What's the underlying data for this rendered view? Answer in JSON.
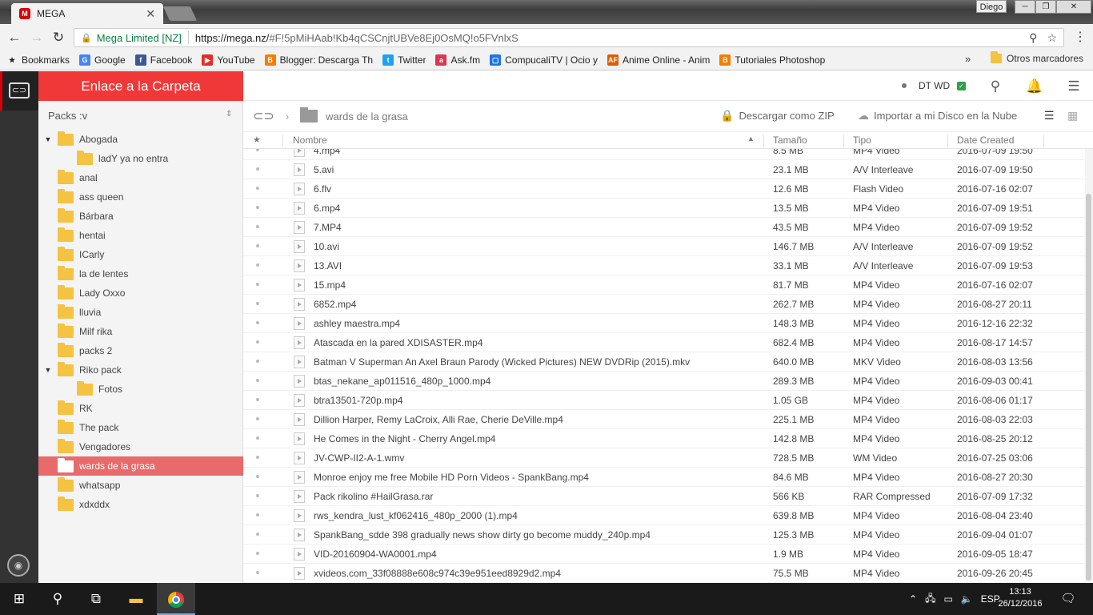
{
  "browser": {
    "tab_title": "MEGA",
    "tab_favicon": "M",
    "user_name": "Diego",
    "url_secure_label": "Mega Limited [NZ]",
    "url_host": "https://mega.nz/",
    "url_rest": "#F!5pMiHAab!Kb4qCSCnjtUBVe8Ej0OsMQ!o5FVnlxS",
    "bookmarks": [
      {
        "label": "Bookmarks",
        "icon": "star-icon",
        "color": "#222222"
      },
      {
        "label": "Google",
        "icon": "google-icon",
        "color": "#4285f4"
      },
      {
        "label": "Facebook",
        "icon": "facebook-icon",
        "color": "#3b5998"
      },
      {
        "label": "YouTube",
        "icon": "youtube-icon",
        "color": "#e52d27"
      },
      {
        "label": "Blogger: Descarga Th",
        "icon": "blogger-icon",
        "color": "#f57d00"
      },
      {
        "label": "Twitter",
        "icon": "twitter-icon",
        "color": "#1da1f2"
      },
      {
        "label": "Ask.fm",
        "icon": "askfm-icon",
        "color": "#db3552"
      },
      {
        "label": "CompucaliTV | Ocio y",
        "icon": "compucali-icon",
        "color": "#1a73e8"
      },
      {
        "label": "Anime Online - Anim",
        "icon": "animeflv-icon",
        "color": "#e05a00"
      },
      {
        "label": "Tutoriales Photoshop",
        "icon": "blogger-icon",
        "color": "#f57d00"
      }
    ],
    "bookmarks_more": "»",
    "other_bookmarks": "Otros marcadores"
  },
  "sidebar": {
    "header": "Enlace a la Carpeta",
    "sort_label": "Packs :v",
    "folders": [
      {
        "label": "Abogada",
        "level": 0,
        "expanded": true
      },
      {
        "label": "ladY ya no entra",
        "level": 1
      },
      {
        "label": "anal",
        "level": 0
      },
      {
        "label": "ass queen",
        "level": 0
      },
      {
        "label": "Bárbara",
        "level": 0
      },
      {
        "label": "hentai",
        "level": 0
      },
      {
        "label": "ICarly",
        "level": 0
      },
      {
        "label": "la de lentes",
        "level": 0
      },
      {
        "label": "Lady Oxxo",
        "level": 0
      },
      {
        "label": "lluvia",
        "level": 0
      },
      {
        "label": "Milf rika",
        "level": 0
      },
      {
        "label": "packs 2",
        "level": 0
      },
      {
        "label": "Riko pack",
        "level": 0,
        "expanded": true
      },
      {
        "label": "Fotos",
        "level": 1
      },
      {
        "label": "RK",
        "level": 0
      },
      {
        "label": "The pack",
        "level": 0
      },
      {
        "label": "Vengadores",
        "level": 0
      },
      {
        "label": "wards de la grasa",
        "level": 0,
        "selected": true
      },
      {
        "label": "whatsapp",
        "level": 0
      },
      {
        "label": "xdxddx",
        "level": 0
      }
    ]
  },
  "topbar": {
    "account": "DT WD"
  },
  "breadcrumb": {
    "folder": "wards de la grasa",
    "zip_label": "Descargar como ZIP",
    "import_label": "Importar a mi Disco en la Nube"
  },
  "table": {
    "headers": {
      "name": "Nombre",
      "size": "Tamaño",
      "type": "Tipo",
      "date": "Date Created"
    },
    "rows": [
      {
        "name": "4.mp4",
        "size": "8.5 MB",
        "type": "MP4 Video",
        "date": "2016-07-09 19:50"
      },
      {
        "name": "5.avi",
        "size": "23.1 MB",
        "type": "A/V Interleave",
        "date": "2016-07-09 19:50"
      },
      {
        "name": "6.flv",
        "size": "12.6 MB",
        "type": "Flash Video",
        "date": "2016-07-16 02:07"
      },
      {
        "name": "6.mp4",
        "size": "13.5 MB",
        "type": "MP4 Video",
        "date": "2016-07-09 19:51"
      },
      {
        "name": "7.MP4",
        "size": "43.5 MB",
        "type": "MP4 Video",
        "date": "2016-07-09 19:52"
      },
      {
        "name": "10.avi",
        "size": "146.7 MB",
        "type": "A/V Interleave",
        "date": "2016-07-09 19:52"
      },
      {
        "name": "13.AVI",
        "size": "33.1 MB",
        "type": "A/V Interleave",
        "date": "2016-07-09 19:53"
      },
      {
        "name": "15.mp4",
        "size": "81.7 MB",
        "type": "MP4 Video",
        "date": "2016-07-16 02:07"
      },
      {
        "name": "6852.mp4",
        "size": "262.7 MB",
        "type": "MP4 Video",
        "date": "2016-08-27 20:11"
      },
      {
        "name": "ashley maestra.mp4",
        "size": "148.3 MB",
        "type": "MP4 Video",
        "date": "2016-12-16 22:32"
      },
      {
        "name": "Atascada en la pared XDISASTER.mp4",
        "size": "682.4 MB",
        "type": "MP4 Video",
        "date": "2016-08-17 14:57"
      },
      {
        "name": "Batman V Superman An Axel Braun Parody (Wicked Pictures) NEW DVDRip (2015).mkv",
        "size": "640.0 MB",
        "type": "MKV Video",
        "date": "2016-08-03 13:56"
      },
      {
        "name": "btas_nekane_ap011516_480p_1000.mp4",
        "size": "289.3 MB",
        "type": "MP4 Video",
        "date": "2016-09-03 00:41"
      },
      {
        "name": "btra13501-720p.mp4",
        "size": "1.05 GB",
        "type": "MP4 Video",
        "date": "2016-08-06 01:17"
      },
      {
        "name": "Dillion Harper, Remy LaCroix, Alli Rae, Cherie DeVille.mp4",
        "size": "225.1 MB",
        "type": "MP4 Video",
        "date": "2016-08-03 22:03"
      },
      {
        "name": "He Comes in the Night - Cherry Angel.mp4",
        "size": "142.8 MB",
        "type": "MP4 Video",
        "date": "2016-08-25 20:12"
      },
      {
        "name": "JV-CWP-II2-A-1.wmv",
        "size": "728.5 MB",
        "type": "WM Video",
        "date": "2016-07-25 03:06"
      },
      {
        "name": "Monroe enjoy me free Mobile HD Porn Videos - SpankBang.mp4",
        "size": "84.6 MB",
        "type": "MP4 Video",
        "date": "2016-08-27 20:30"
      },
      {
        "name": "Pack rikolino #HailGrasa.rar",
        "size": "566 KB",
        "type": "RAR Compressed",
        "date": "2016-07-09 17:32"
      },
      {
        "name": "rws_kendra_lust_kf062416_480p_2000 (1).mp4",
        "size": "639.8 MB",
        "type": "MP4 Video",
        "date": "2016-08-04 23:40"
      },
      {
        "name": "SpankBang_sdde 398 gradually news show dirty go become muddy_240p.mp4",
        "size": "125.3 MB",
        "type": "MP4 Video",
        "date": "2016-09-04 01:07"
      },
      {
        "name": "VID-20160904-WA0001.mp4",
        "size": "1.9 MB",
        "type": "MP4 Video",
        "date": "2016-09-05 18:47"
      },
      {
        "name": "xvideos.com_33f08888e608c974c39e951eed8929d2.mp4",
        "size": "75.5 MB",
        "type": "MP4 Video",
        "date": "2016-09-26 20:45"
      }
    ]
  },
  "taskbar": {
    "language": "ESP",
    "time": "13:13",
    "date": "26/12/2016"
  },
  "colors": {
    "mega_red": "#f03838",
    "selected_row": "#e96a6a",
    "folder_yellow": "#f5c342"
  }
}
